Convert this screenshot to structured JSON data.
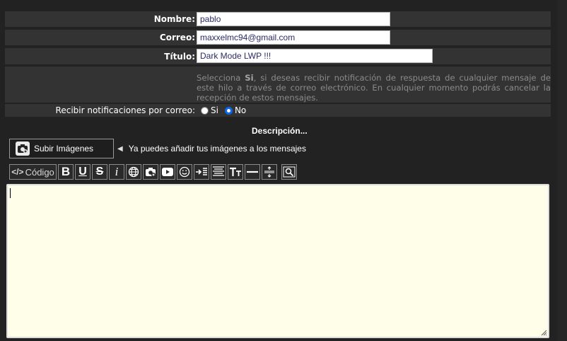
{
  "form": {
    "name_label": "Nombre:",
    "name_value": "pablo",
    "email_label": "Correo:",
    "email_value": "maxxelmc94@gmail.com",
    "title_label": "Título:",
    "title_value": "Dark Mode LWP !!!",
    "notice_part1": "Selecciona ",
    "notice_bold": "Si",
    "notice_part2": ", si deseas recibir notificación de respuesta de cualquier mensaje de este hilo a través de correo electrónico. En cualquier momento podrás cancelar la recepción de estos mensajes.",
    "notify_label": "Recibir notificaciones por correo:",
    "notify_options": {
      "yes": "Si",
      "no": "No"
    },
    "notify_selected": "No"
  },
  "description_title": "Descripción...",
  "upload": {
    "button_label": "Subir Imágenes",
    "hint": "Ya puedes añadir tus imágenes a los mensajes"
  },
  "toolbar": {
    "code_label": "Código",
    "buttons": [
      "bold-icon",
      "underline-icon",
      "strikethrough-icon",
      "italic-icon",
      "globe-link-icon",
      "camera-image-icon",
      "youtube-icon",
      "smiley-icon",
      "indent-icon",
      "align-icon",
      "font-size-icon",
      "horizontal-rule-icon",
      "expand-icon",
      "preview-search-icon"
    ]
  },
  "editor": {
    "value": ""
  },
  "colors": {
    "background": "#222222",
    "row": "#333333",
    "editor_bg": "#fefee9",
    "radio_accent": "#0a68e8"
  }
}
